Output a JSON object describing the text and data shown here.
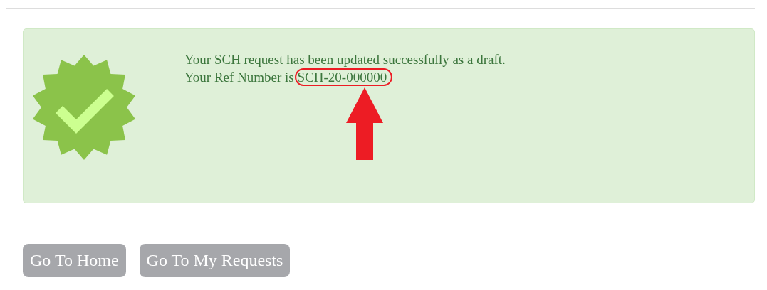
{
  "alert": {
    "kind": "success",
    "message": "Your SCH request has been updated successfully as a draft.",
    "ref_label": "Your Ref Number is",
    "ref_number": "SCH-20-000000",
    "ref_highlighted": true
  },
  "buttons": [
    {
      "label": "Go To Home"
    },
    {
      "label": "Go To My Requests"
    }
  ]
}
